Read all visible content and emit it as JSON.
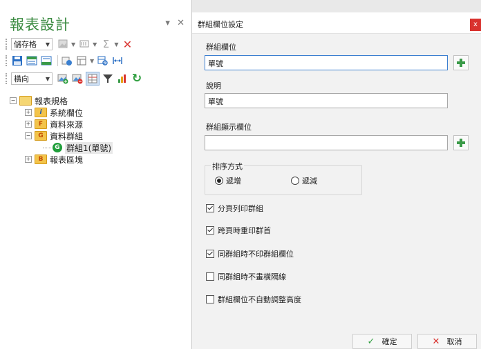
{
  "panel": {
    "title": "報表設計",
    "controls": {
      "pin": "▾",
      "close": "✕"
    }
  },
  "toolbar": {
    "row1": {
      "combo_value": "儲存格"
    },
    "row3": {
      "combo_value": "橫向"
    }
  },
  "tree": {
    "root": "報表規格",
    "system_fields": {
      "icon": "i",
      "label": "系統欄位"
    },
    "data_source": {
      "icon": "F",
      "label": "資料來源"
    },
    "data_group": {
      "icon": "G",
      "label": "資料群組"
    },
    "group_item": {
      "icon": "G",
      "label": "群組1(單號)"
    },
    "report_blocks": {
      "icon": "B",
      "label": "報表區塊"
    }
  },
  "dialog": {
    "title": "群組欄位設定",
    "close": "x",
    "group_field": {
      "label": "群組欄位",
      "value": "單號"
    },
    "description": {
      "label": "說明",
      "value": "單號"
    },
    "display_field": {
      "label": "群組顯示欄位",
      "value": ""
    },
    "sort": {
      "title": "排序方式",
      "asc": "遞增",
      "desc": "遞減",
      "selected": "asc"
    },
    "checks": [
      {
        "label": "分頁列印群組",
        "checked": true
      },
      {
        "label": "跨頁時重印群首",
        "checked": true
      },
      {
        "label": "同群組時不印群組欄位",
        "checked": true
      },
      {
        "label": "同群組時不畫橫隔線",
        "checked": false
      },
      {
        "label": "群組欄位不自動調整高度",
        "checked": false
      }
    ],
    "ok": "確定",
    "cancel": "取消"
  },
  "colors": {
    "title_green": "#3a8a40",
    "close_red": "#d9322e",
    "focus_blue": "#3c7fd0"
  }
}
